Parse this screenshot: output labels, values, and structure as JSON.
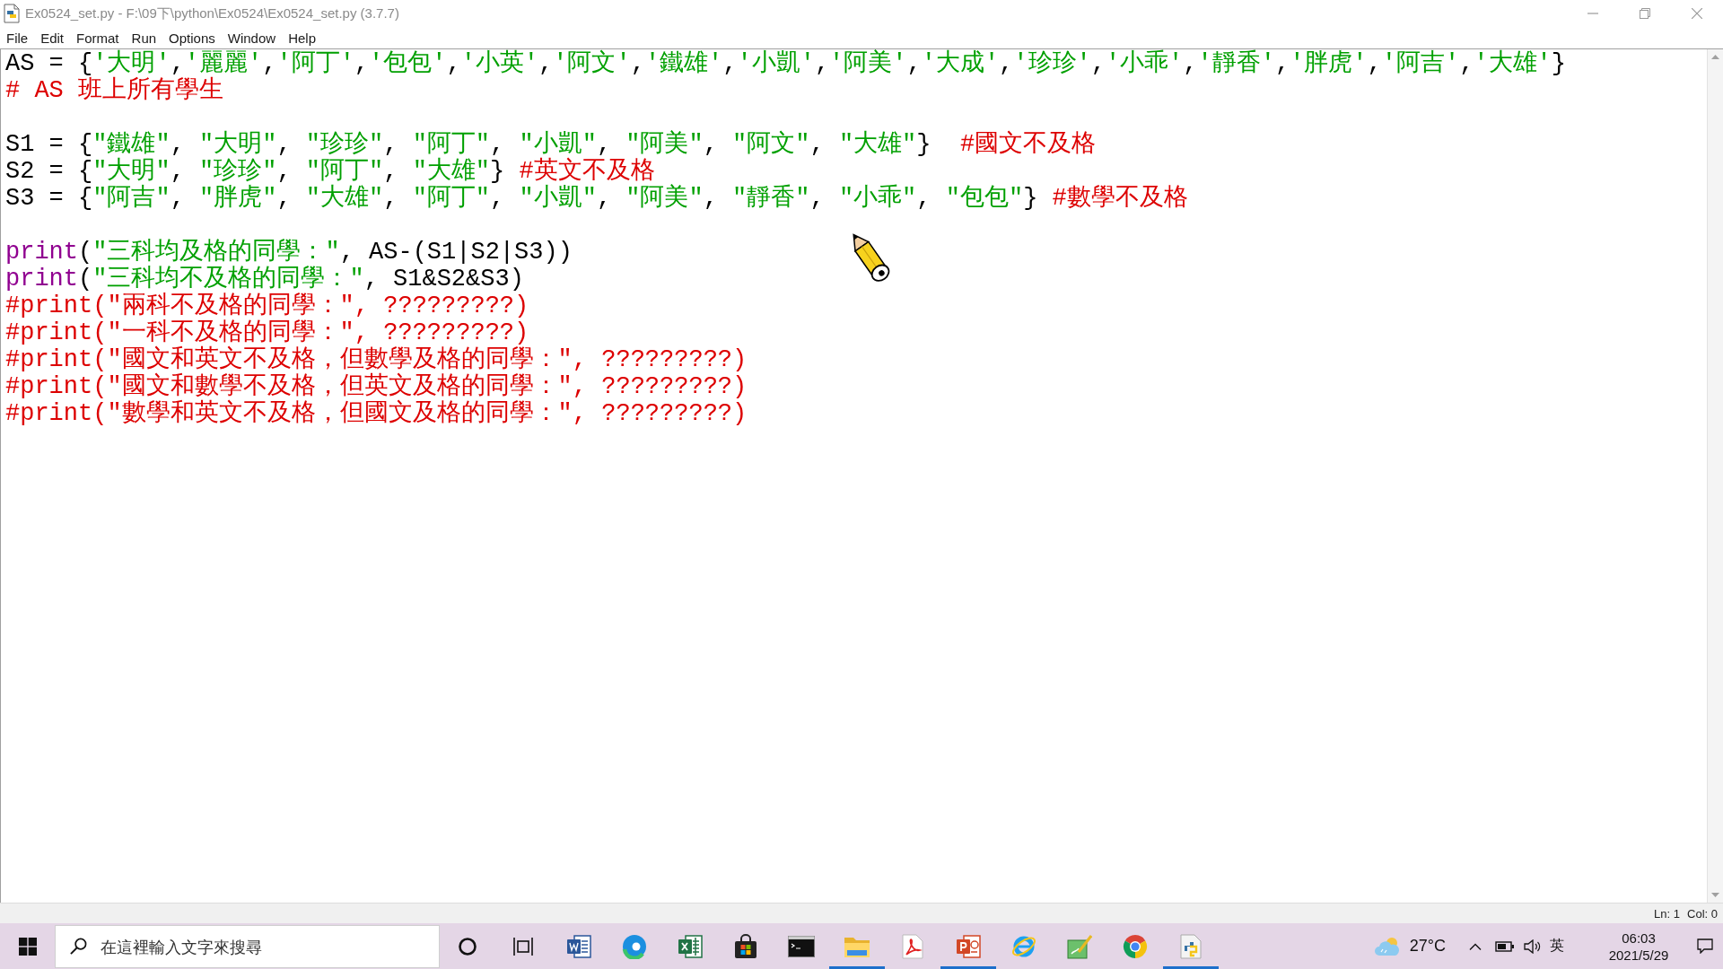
{
  "window": {
    "title": "Ex0524_set.py - F:\\09下\\python\\Ex0524\\Ex0524_set.py (3.7.7)"
  },
  "menu": [
    "File",
    "Edit",
    "Format",
    "Run",
    "Options",
    "Window",
    "Help"
  ],
  "editor": {
    "blocks": [
      {
        "lines": [
          {
            "tokens": [
              {
                "kind": "plain",
                "text": "AS = {"
              },
              {
                "kind": "string",
                "text": "'大明'"
              },
              {
                "kind": "plain",
                "text": ","
              },
              {
                "kind": "string",
                "text": "'麗麗'"
              },
              {
                "kind": "plain",
                "text": ","
              },
              {
                "kind": "string",
                "text": "'阿丁'"
              },
              {
                "kind": "plain",
                "text": ","
              },
              {
                "kind": "string",
                "text": "'包包'"
              },
              {
                "kind": "plain",
                "text": ","
              },
              {
                "kind": "string",
                "text": "'小英'"
              },
              {
                "kind": "plain",
                "text": ","
              },
              {
                "kind": "string",
                "text": "'阿文'"
              },
              {
                "kind": "plain",
                "text": ","
              },
              {
                "kind": "string",
                "text": "'鐵雄'"
              },
              {
                "kind": "plain",
                "text": ","
              },
              {
                "kind": "string",
                "text": "'小凱'"
              },
              {
                "kind": "plain",
                "text": ","
              },
              {
                "kind": "string",
                "text": "'阿美'"
              },
              {
                "kind": "plain",
                "text": ","
              },
              {
                "kind": "string",
                "text": "'大成'"
              },
              {
                "kind": "plain",
                "text": ","
              },
              {
                "kind": "string",
                "text": "'珍珍'"
              },
              {
                "kind": "plain",
                "text": ","
              },
              {
                "kind": "string",
                "text": "'小乖'"
              },
              {
                "kind": "plain",
                "text": ","
              },
              {
                "kind": "string",
                "text": "'靜香'"
              },
              {
                "kind": "plain",
                "text": ","
              },
              {
                "kind": "string",
                "text": "'胖虎'"
              },
              {
                "kind": "plain",
                "text": ","
              },
              {
                "kind": "string",
                "text": "'阿吉'"
              },
              {
                "kind": "plain",
                "text": ","
              },
              {
                "kind": "string",
                "text": "'大雄'"
              },
              {
                "kind": "plain",
                "text": "}"
              }
            ]
          },
          {
            "tokens": [
              {
                "kind": "comment",
                "text": "# AS 班上所有學生"
              }
            ]
          }
        ]
      },
      {
        "lines": [
          {
            "tokens": [
              {
                "kind": "plain",
                "text": "S1 = {"
              },
              {
                "kind": "string",
                "text": "\"鐵雄\""
              },
              {
                "kind": "plain",
                "text": ", "
              },
              {
                "kind": "string",
                "text": "\"大明\""
              },
              {
                "kind": "plain",
                "text": ", "
              },
              {
                "kind": "string",
                "text": "\"珍珍\""
              },
              {
                "kind": "plain",
                "text": ", "
              },
              {
                "kind": "string",
                "text": "\"阿丁\""
              },
              {
                "kind": "plain",
                "text": ", "
              },
              {
                "kind": "string",
                "text": "\"小凱\""
              },
              {
                "kind": "plain",
                "text": ", "
              },
              {
                "kind": "string",
                "text": "\"阿美\""
              },
              {
                "kind": "plain",
                "text": ", "
              },
              {
                "kind": "string",
                "text": "\"阿文\""
              },
              {
                "kind": "plain",
                "text": ", "
              },
              {
                "kind": "string",
                "text": "\"大雄\""
              },
              {
                "kind": "plain",
                "text": "}  "
              },
              {
                "kind": "comment",
                "text": "#國文不及格"
              }
            ]
          },
          {
            "tokens": [
              {
                "kind": "plain",
                "text": "S2 = {"
              },
              {
                "kind": "string",
                "text": "\"大明\""
              },
              {
                "kind": "plain",
                "text": ", "
              },
              {
                "kind": "string",
                "text": "\"珍珍\""
              },
              {
                "kind": "plain",
                "text": ", "
              },
              {
                "kind": "string",
                "text": "\"阿丁\""
              },
              {
                "kind": "plain",
                "text": ", "
              },
              {
                "kind": "string",
                "text": "\"大雄\""
              },
              {
                "kind": "plain",
                "text": "} "
              },
              {
                "kind": "comment",
                "text": "#英文不及格"
              }
            ]
          },
          {
            "tokens": [
              {
                "kind": "plain",
                "text": "S3 = {"
              },
              {
                "kind": "string",
                "text": "\"阿吉\""
              },
              {
                "kind": "plain",
                "text": ", "
              },
              {
                "kind": "string",
                "text": "\"胖虎\""
              },
              {
                "kind": "plain",
                "text": ", "
              },
              {
                "kind": "string",
                "text": "\"大雄\""
              },
              {
                "kind": "plain",
                "text": ", "
              },
              {
                "kind": "string",
                "text": "\"阿丁\""
              },
              {
                "kind": "plain",
                "text": ", "
              },
              {
                "kind": "string",
                "text": "\"小凱\""
              },
              {
                "kind": "plain",
                "text": ", "
              },
              {
                "kind": "string",
                "text": "\"阿美\""
              },
              {
                "kind": "plain",
                "text": ", "
              },
              {
                "kind": "string",
                "text": "\"靜香\""
              },
              {
                "kind": "plain",
                "text": ", "
              },
              {
                "kind": "string",
                "text": "\"小乖\""
              },
              {
                "kind": "plain",
                "text": ", "
              },
              {
                "kind": "string",
                "text": "\"包包\""
              },
              {
                "kind": "plain",
                "text": "} "
              },
              {
                "kind": "comment",
                "text": "#數學不及格"
              }
            ]
          }
        ]
      },
      {
        "lines": [
          {
            "tokens": [
              {
                "kind": "builtin",
                "text": "print"
              },
              {
                "kind": "plain",
                "text": "("
              },
              {
                "kind": "string",
                "text": "\"三科均及格的同學：\""
              },
              {
                "kind": "plain",
                "text": ", AS-(S1|S2|S3))"
              }
            ]
          },
          {
            "tokens": [
              {
                "kind": "builtin",
                "text": "print"
              },
              {
                "kind": "plain",
                "text": "("
              },
              {
                "kind": "string",
                "text": "\"三科均不及格的同學：\""
              },
              {
                "kind": "plain",
                "text": ", S1&S2&S3)"
              }
            ]
          },
          {
            "tokens": [
              {
                "kind": "comment",
                "text": "#print(\"兩科不及格的同學：\", ?????????)"
              }
            ]
          },
          {
            "tokens": [
              {
                "kind": "comment",
                "text": "#print(\"一科不及格的同學：\", ?????????)"
              }
            ]
          },
          {
            "tokens": [
              {
                "kind": "comment",
                "text": "#print(\"國文和英文不及格，但數學及格的同學：\", ?????????)"
              }
            ]
          },
          {
            "tokens": [
              {
                "kind": "comment",
                "text": "#print(\"國文和數學不及格，但英文及格的同學：\", ?????????)"
              }
            ]
          },
          {
            "tokens": [
              {
                "kind": "comment",
                "text": "#print(\"數學和英文不及格，但國文及格的同學：\", ?????????)"
              }
            ]
          }
        ]
      }
    ]
  },
  "status_bar": {
    "items": [
      "Ln: 1",
      "Col: 0"
    ]
  },
  "taskbar": {
    "search": {
      "placeholder": "在這裡輸入文字來搜尋"
    },
    "apps": [
      {
        "kind": "word",
        "running": false
      },
      {
        "kind": "edge",
        "running": false
      },
      {
        "kind": "excel",
        "running": false
      },
      {
        "kind": "store",
        "running": false
      },
      {
        "kind": "terminal",
        "running": false
      },
      {
        "kind": "explorer",
        "running": true
      },
      {
        "kind": "acrobat",
        "running": false
      },
      {
        "kind": "powerpoint",
        "running": true
      },
      {
        "kind": "ie",
        "running": false
      },
      {
        "kind": "paint",
        "running": false
      },
      {
        "kind": "chrome",
        "running": false
      },
      {
        "kind": "python",
        "running": true
      }
    ],
    "tray": {
      "temperature": "27°C",
      "language": "英",
      "time": "06:03",
      "date": "2021/5/29"
    }
  }
}
